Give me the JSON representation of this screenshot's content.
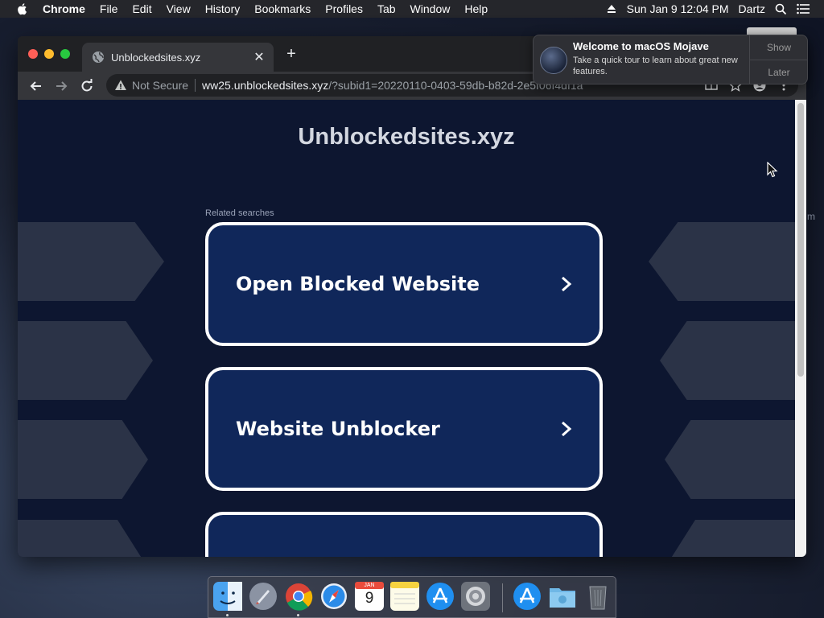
{
  "menubar": {
    "app_name": "Chrome",
    "menus": [
      "File",
      "Edit",
      "View",
      "History",
      "Bookmarks",
      "Profiles",
      "Tab",
      "Window",
      "Help"
    ],
    "datetime": "Sun Jan 9  12:04 PM",
    "user": "Dartz"
  },
  "browser": {
    "tab_title": "Unblockedsites.xyz",
    "new_tab_label": "+",
    "security_label": "Not Secure",
    "url_host": "ww25.unblockedsites.xyz",
    "url_path": "/?subid1=20220110-0403-59db-b82d-2e5f06f4df1a"
  },
  "page": {
    "site_title": "Unblockedsites.xyz",
    "related_label": "Related searches",
    "cards": [
      "Open Blocked Website",
      "Website Unblocker",
      ""
    ]
  },
  "notification": {
    "title": "Welcome to macOS Mojave",
    "body": "Take a quick tour to learn about great new features.",
    "show_label": "Show",
    "later_label": "Later"
  },
  "behind_text": "m",
  "calendar_day": "9",
  "calendar_month": "JAN",
  "dock": {
    "apps": [
      "finder",
      "launchpad",
      "chrome",
      "safari",
      "calendar",
      "notes",
      "app-store",
      "system-preferences",
      "app-store-download",
      "downloads-folder",
      "trash"
    ]
  },
  "colors": {
    "page_bg": "#0d1630",
    "card_bg": "#10275a",
    "card_border": "#ffffff"
  }
}
